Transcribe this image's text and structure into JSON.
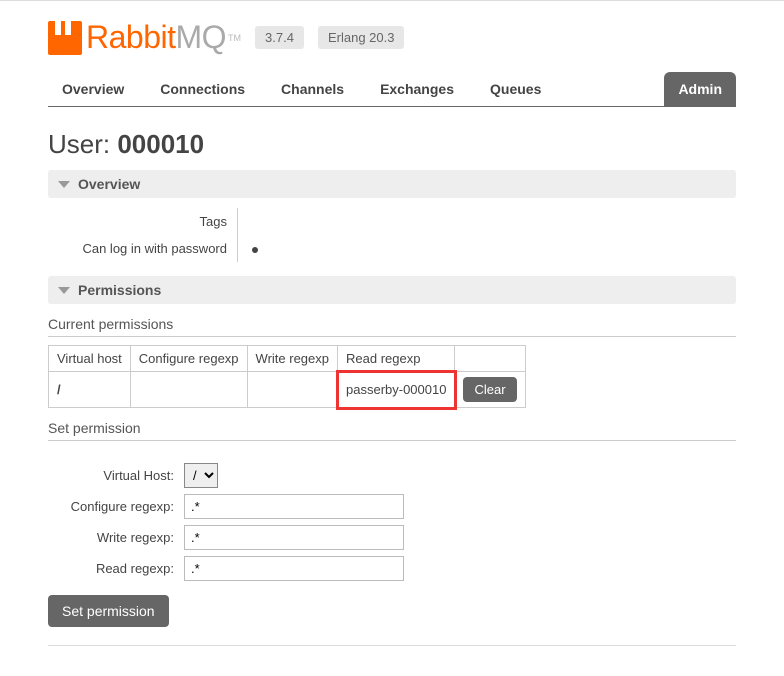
{
  "logo": {
    "brand_a": "Rabbit",
    "brand_b": "MQ",
    "tm": "TM"
  },
  "version_pill": "3.7.4",
  "erlang_pill": "Erlang 20.3",
  "tabs": {
    "overview": "Overview",
    "connections": "Connections",
    "channels": "Channels",
    "exchanges": "Exchanges",
    "queues": "Queues",
    "admin": "Admin"
  },
  "heading": {
    "prefix": "User: ",
    "name": "000010"
  },
  "sections": {
    "overview": "Overview",
    "permissions": "Permissions"
  },
  "overview_kv": {
    "tags_label": "Tags",
    "tags_value": "",
    "login_label": "Can log in with password"
  },
  "perm": {
    "current_title": "Current permissions",
    "headers": {
      "vhost": "Virtual host",
      "configure": "Configure regexp",
      "write": "Write regexp",
      "read": "Read regexp"
    },
    "row": {
      "vhost": "/",
      "configure": "",
      "write": "",
      "read": "passerby-000010",
      "clear_btn": "Clear"
    },
    "set_title": "Set permission",
    "form": {
      "vhost_label": "Virtual Host:",
      "vhost_value": "/",
      "configure_label": "Configure regexp:",
      "configure_value": ".*",
      "write_label": "Write regexp:",
      "write_value": ".*",
      "read_label": "Read regexp:",
      "read_value": ".*",
      "submit": "Set permission"
    }
  }
}
